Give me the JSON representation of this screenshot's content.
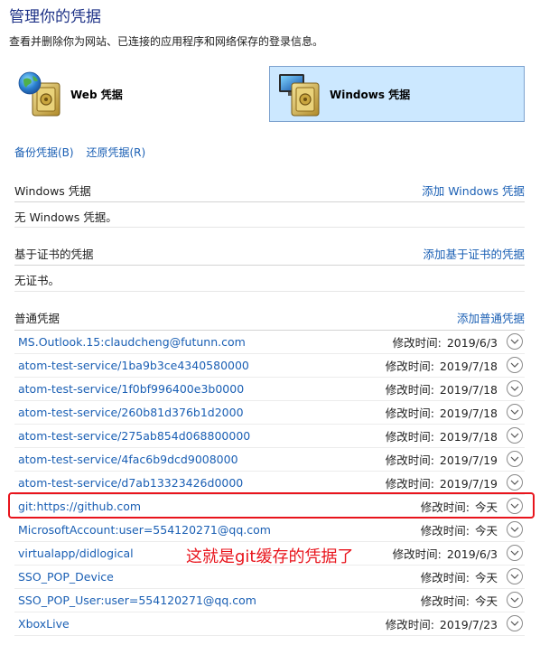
{
  "header": {
    "title": "管理你的凭据",
    "subtitle": "查看并删除你为网站、已连接的应用程序和网络保存的登录信息。"
  },
  "credential_types": {
    "web": {
      "label": "Web 凭据",
      "icon": "globe-vault-icon"
    },
    "windows": {
      "label": "Windows 凭据",
      "icon": "monitor-vault-icon",
      "selected": true
    }
  },
  "actions": {
    "backup": "备份凭据(B)",
    "restore": "还原凭据(R)"
  },
  "windows_section": {
    "title": "Windows 凭据",
    "add": "添加 Windows 凭据",
    "empty": "无 Windows 凭据。"
  },
  "cert_section": {
    "title": "基于证书的凭据",
    "add": "添加基于证书的凭据",
    "empty": "无证书。"
  },
  "generic_section": {
    "title": "普通凭据",
    "add": "添加普通凭据",
    "modified_label": "修改时间:",
    "items": [
      {
        "name": "MS.Outlook.15:claudcheng@futunn.com",
        "date": "2019/6/3"
      },
      {
        "name": "atom-test-service/1ba9b3ce4340580000",
        "date": "2019/7/18"
      },
      {
        "name": "atom-test-service/1f0bf996400e3b0000",
        "date": "2019/7/18"
      },
      {
        "name": "atom-test-service/260b81d376b1d2000",
        "date": "2019/7/18"
      },
      {
        "name": "atom-test-service/275ab854d068800000",
        "date": "2019/7/18"
      },
      {
        "name": "atom-test-service/4fac6b9dcd9008000",
        "date": "2019/7/19"
      },
      {
        "name": "atom-test-service/d7ab13323426d0000",
        "date": "2019/7/19"
      },
      {
        "name": "git:https://github.com",
        "date": "今天"
      },
      {
        "name": "MicrosoftAccount:user=554120271@qq.com",
        "date": "今天"
      },
      {
        "name": "virtualapp/didlogical",
        "date": "2019/6/3"
      },
      {
        "name": "SSO_POP_Device",
        "date": "今天"
      },
      {
        "name": "SSO_POP_User:user=554120271@qq.com",
        "date": "今天"
      },
      {
        "name": "XboxLive",
        "date": "2019/7/23"
      }
    ]
  },
  "annotation": {
    "text": "这就是git缓存的凭据了",
    "color": "#e8141c"
  },
  "colors": {
    "link": "#1a5fb4",
    "title": "#1e3287",
    "selected_bg": "#cce8ff",
    "selected_border": "#7da2ce",
    "highlight": "#e8141c"
  }
}
